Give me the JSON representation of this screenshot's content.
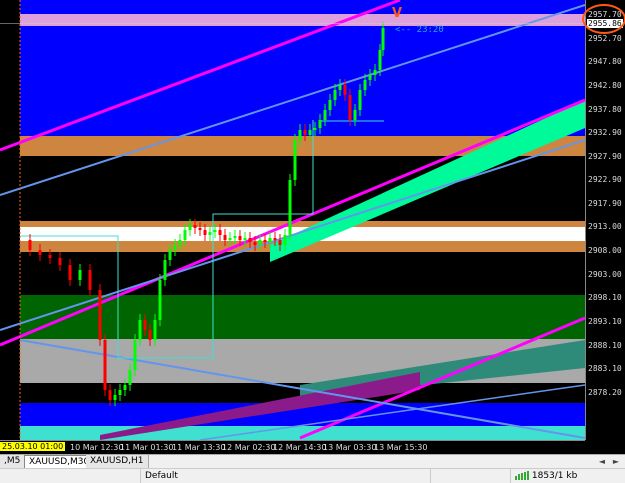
{
  "price_axis": {
    "ticks": [
      "2957.70",
      "2952.70",
      "2947.80",
      "2942.80",
      "2937.80",
      "2932.90",
      "2927.90",
      "2922.90",
      "2917.90",
      "2913.00",
      "2908.00",
      "2903.00",
      "2898.10",
      "2893.10",
      "2888.10",
      "2883.10",
      "2878.20"
    ],
    "current_price": "2955.86"
  },
  "time_axis": {
    "start_label": "25.03.10 01:00",
    "ticks": [
      "10 Mar 12:30",
      "11 Mar 01:30",
      "11 Mar 13:30",
      "12 Mar 02:30",
      "12 Mar 14:30",
      "13 Mar 03:30",
      "13 Mar 15:30"
    ]
  },
  "countdown": "<-- 23:20",
  "annotation": {
    "mark": "V",
    "color": "#ff5a14"
  },
  "tabs": {
    "items": [
      ",M5",
      "XAUUSD,M30",
      "XAUUSD,H1"
    ],
    "active": 1,
    "nav_left": "◄",
    "nav_right": "►"
  },
  "status": {
    "profile": "Default",
    "traffic": "1853/1 kb",
    "traffic_icon": "bars-icon"
  },
  "colors": {
    "zone_blue": "#0000ff",
    "zone_orange": "#cd853f",
    "zone_green": "#006400",
    "zone_gray": "#a9a9a9",
    "zone_pink": "#dda0dd",
    "zone_cyan": "#40e0d0",
    "zone_white": "#ffffff",
    "line_magenta": "#ff00ff",
    "line_blue": "#6495ed",
    "line_cyan": "#40e0d0",
    "channel_green": "#00fa9a",
    "candle_up": "#00ff00",
    "candle_down": "#ff0000"
  }
}
